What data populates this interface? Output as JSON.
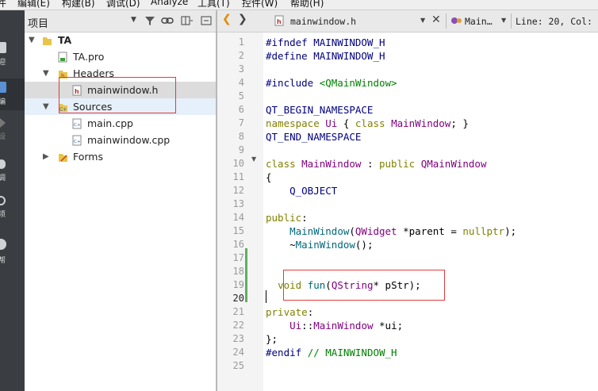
{
  "menubar": {
    "items": [
      "编辑(E)",
      "构建(B)",
      "调试(D)",
      "Analyze",
      "工具(T)",
      "控件(W)",
      "帮助(H)"
    ],
    "partial_first": "件"
  },
  "modebar": {
    "items": [
      {
        "icon": "welcome-icon",
        "label": "迎"
      },
      {
        "icon": "edit-icon",
        "label": "编"
      },
      {
        "icon": "design-icon",
        "label": "设"
      },
      {
        "icon": "debug-icon",
        "label": "调"
      },
      {
        "icon": "project-icon",
        "label": "项"
      },
      {
        "icon": "help-icon",
        "label": "帮"
      }
    ]
  },
  "project_panel": {
    "title": "项目",
    "tree": {
      "root": "TA",
      "items": [
        {
          "label": "TA.pro",
          "icon": "pro-file-icon"
        },
        {
          "label": "Headers",
          "icon": "headers-folder-icon"
        },
        {
          "label": "mainwindow.h",
          "icon": "header-file-icon"
        },
        {
          "label": "Sources",
          "icon": "sources-folder-icon"
        },
        {
          "label": "main.cpp",
          "icon": "cpp-file-icon"
        },
        {
          "label": "mainwindow.cpp",
          "icon": "cpp-file-icon"
        },
        {
          "label": "Forms",
          "icon": "forms-folder-icon"
        }
      ]
    }
  },
  "editor": {
    "file_name": "mainwindow.h",
    "symbol": "Main…",
    "position": "Line: 20, Col:",
    "current_line": 20,
    "line_numbers": [
      "1",
      "2",
      "3",
      "4",
      "5",
      "6",
      "7",
      "8",
      "9",
      "10",
      "11",
      "12",
      "13",
      "14",
      "15",
      "16",
      "17",
      "18",
      "19",
      "20",
      "21",
      "22",
      "23",
      "24",
      "25"
    ]
  },
  "code_lines": [
    [
      {
        "c": "pp",
        "t": "#ifndef MAINWINDOW_H"
      }
    ],
    [
      {
        "c": "pp",
        "t": "#define MAINWINDOW_H"
      }
    ],
    [],
    [
      {
        "c": "pp",
        "t": "#include "
      },
      {
        "c": "str",
        "t": "<QMainWindow>"
      }
    ],
    [],
    [
      {
        "c": "pp",
        "t": "QT_BEGIN_NAMESPACE"
      }
    ],
    [
      {
        "c": "kw",
        "t": "namespace "
      },
      {
        "c": "ty",
        "t": "Ui"
      },
      {
        "c": "",
        "t": " { "
      },
      {
        "c": "kw",
        "t": "class "
      },
      {
        "c": "ty",
        "t": "MainWindow"
      },
      {
        "c": "",
        "t": "; }"
      }
    ],
    [
      {
        "c": "pp",
        "t": "QT_END_NAMESPACE"
      }
    ],
    [],
    [
      {
        "c": "kw",
        "t": "class "
      },
      {
        "c": "ty",
        "t": "MainWindow"
      },
      {
        "c": "",
        "t": " : "
      },
      {
        "c": "kw",
        "t": "public "
      },
      {
        "c": "ty",
        "t": "QMainWindow"
      }
    ],
    [
      {
        "c": "",
        "t": "{"
      }
    ],
    [
      {
        "c": "",
        "t": "    "
      },
      {
        "c": "pp",
        "t": "Q_OBJECT"
      }
    ],
    [],
    [
      {
        "c": "kw",
        "t": "public"
      },
      {
        "c": "",
        "t": ":"
      }
    ],
    [
      {
        "c": "",
        "t": "    "
      },
      {
        "c": "fn",
        "t": "MainWindow"
      },
      {
        "c": "",
        "t": "("
      },
      {
        "c": "ty",
        "t": "QWidget"
      },
      {
        "c": "",
        "t": " *parent = "
      },
      {
        "c": "kw",
        "t": "nullptr"
      },
      {
        "c": "",
        "t": ");"
      }
    ],
    [
      {
        "c": "",
        "t": "    ~"
      },
      {
        "c": "fn",
        "t": "MainWindow"
      },
      {
        "c": "",
        "t": "();"
      }
    ],
    [],
    [],
    [
      {
        "c": "",
        "t": "  "
      },
      {
        "c": "kw",
        "t": "void "
      },
      {
        "c": "fn",
        "t": "fun"
      },
      {
        "c": "",
        "t": "("
      },
      {
        "c": "ty",
        "t": "QString"
      },
      {
        "c": "",
        "t": "* pStr);"
      }
    ],
    [],
    [
      {
        "c": "kw",
        "t": "private"
      },
      {
        "c": "",
        "t": ":"
      }
    ],
    [
      {
        "c": "",
        "t": "    "
      },
      {
        "c": "ty",
        "t": "Ui"
      },
      {
        "c": "",
        "t": "::"
      },
      {
        "c": "ty",
        "t": "MainWindow"
      },
      {
        "c": "",
        "t": " *ui;"
      }
    ],
    [
      {
        "c": "",
        "t": "};"
      }
    ],
    [
      {
        "c": "pp",
        "t": "#endif "
      },
      {
        "c": "cm",
        "t": "// MAINWINDOW_H"
      }
    ],
    []
  ],
  "colors": {
    "highlight_box": "#e03b3b",
    "modebar_bg": "#3a3e42",
    "selected_row": "#dcdcdc"
  }
}
